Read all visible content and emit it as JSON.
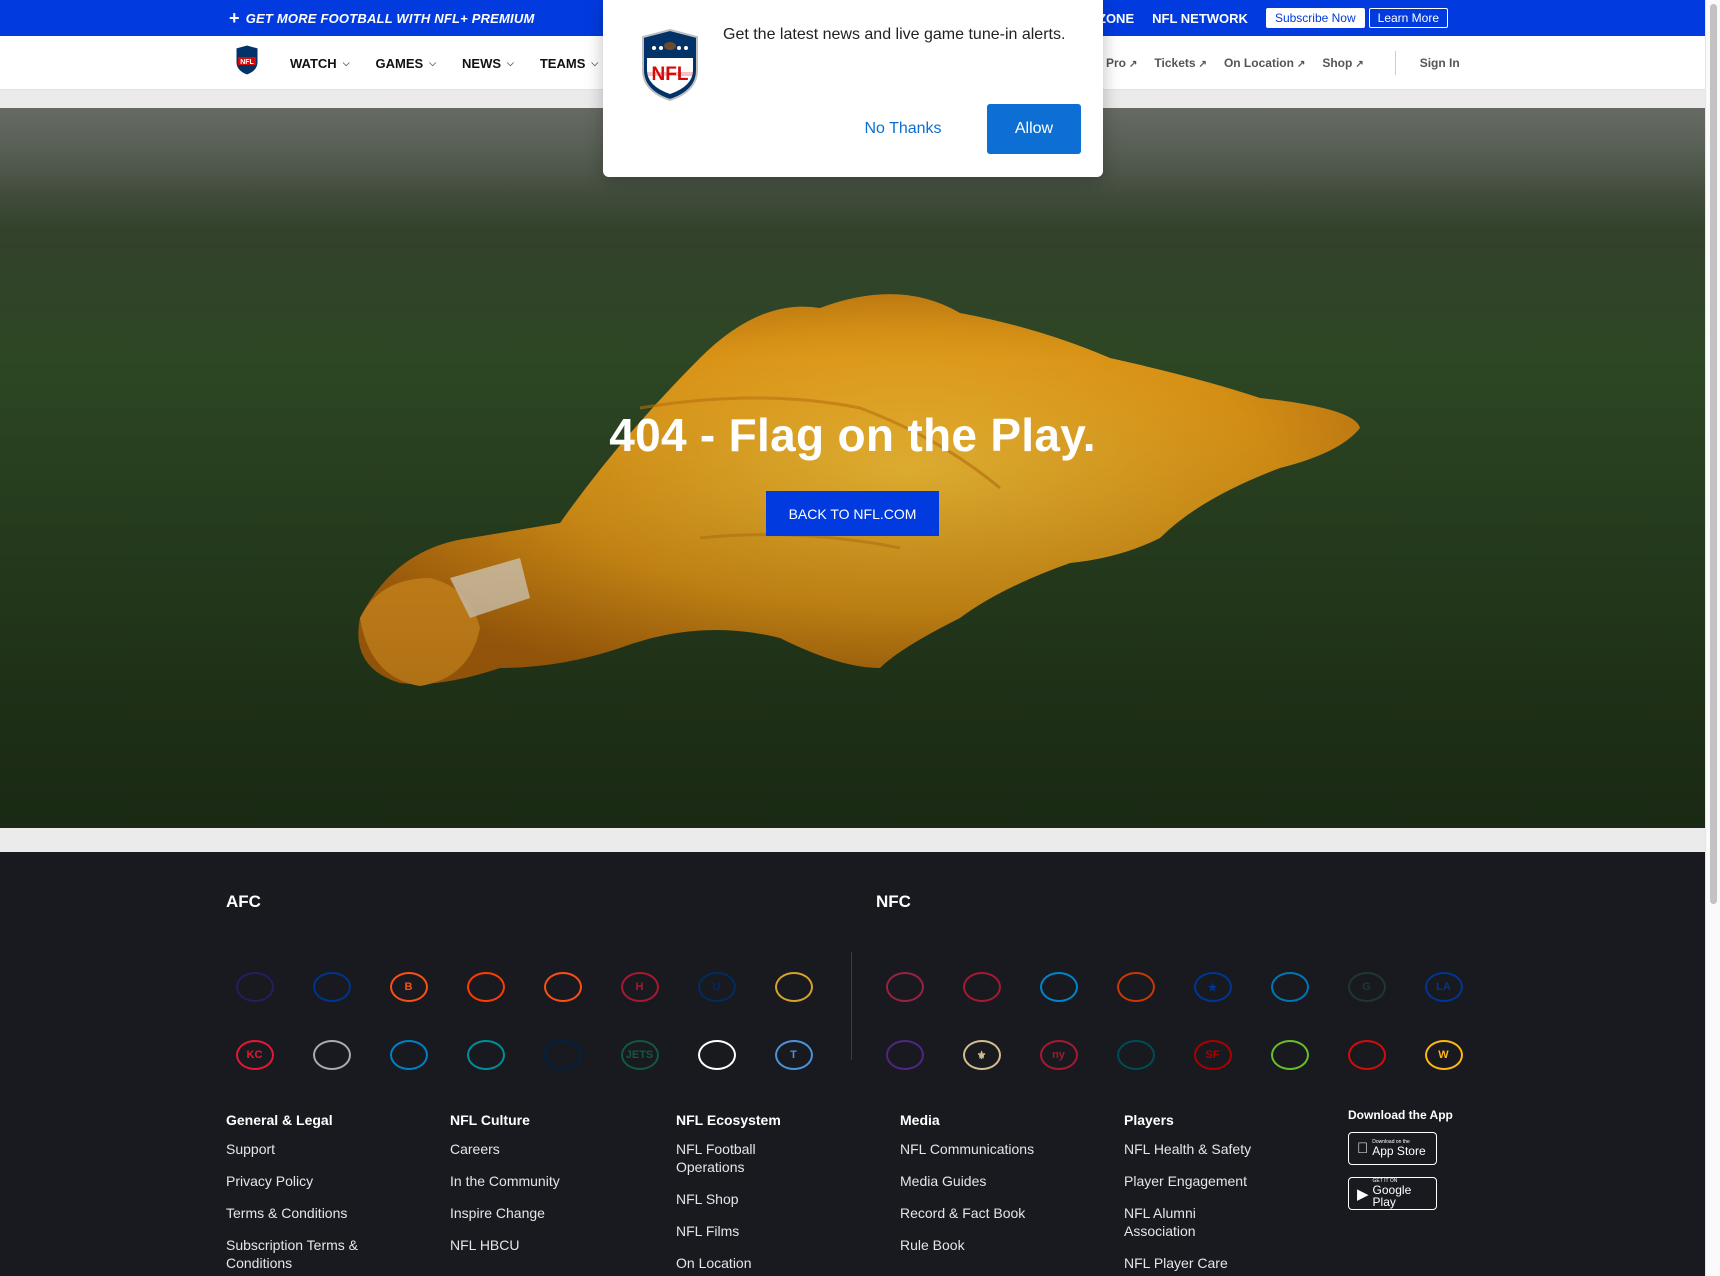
{
  "promo": {
    "text": "GET MORE FOOTBALL WITH NFL+ PREMIUM",
    "redzone": "ZONE",
    "network": "NFL NETWORK",
    "subscribe": "Subscribe Now",
    "learn_more": "Learn More"
  },
  "nav": {
    "items": [
      "WATCH",
      "GAMES",
      "NEWS",
      "TEAMS"
    ],
    "right": [
      "Pro",
      "Tickets",
      "On Location",
      "Shop"
    ],
    "sign_in": "Sign In"
  },
  "hero": {
    "title": "404 - Flag on the Play.",
    "button": "BACK TO NFL.COM"
  },
  "modal": {
    "message": "Get the latest news and live game tune-in alerts.",
    "no_thanks": "No Thanks",
    "allow": "Allow",
    "logo_text": "NFL"
  },
  "footer": {
    "afc_label": "AFC",
    "nfc_label": "NFC",
    "afc_teams": [
      {
        "name": "ravens-logo",
        "color": "#2a1a5e",
        "abbr": ""
      },
      {
        "name": "bills-logo",
        "color": "#00338d",
        "abbr": ""
      },
      {
        "name": "bengals-logo",
        "color": "#fb4f14",
        "abbr": "B"
      },
      {
        "name": "browns-logo",
        "color": "#ff3c00",
        "abbr": ""
      },
      {
        "name": "broncos-logo",
        "color": "#fb4f14",
        "abbr": ""
      },
      {
        "name": "texans-logo",
        "color": "#a71930",
        "abbr": "H"
      },
      {
        "name": "colts-logo",
        "color": "#002c5f",
        "abbr": "U"
      },
      {
        "name": "jaguars-logo",
        "color": "#d7a22a",
        "abbr": ""
      },
      {
        "name": "chiefs-logo",
        "color": "#e31837",
        "abbr": "KC"
      },
      {
        "name": "raiders-logo",
        "color": "#a5acaf",
        "abbr": ""
      },
      {
        "name": "chargers-logo",
        "color": "#0080c6",
        "abbr": ""
      },
      {
        "name": "dolphins-logo",
        "color": "#008e97",
        "abbr": ""
      },
      {
        "name": "patriots-logo",
        "color": "#002244",
        "abbr": ""
      },
      {
        "name": "jets-logo",
        "color": "#125740",
        "abbr": "JETS"
      },
      {
        "name": "steelers-logo",
        "color": "#ffffff",
        "abbr": ""
      },
      {
        "name": "titans-logo",
        "color": "#4b92db",
        "abbr": "T"
      }
    ],
    "nfc_teams": [
      {
        "name": "cardinals-logo",
        "color": "#97233f",
        "abbr": ""
      },
      {
        "name": "falcons-logo",
        "color": "#a71930",
        "abbr": ""
      },
      {
        "name": "panthers-logo",
        "color": "#0085ca",
        "abbr": ""
      },
      {
        "name": "bears-logo",
        "color": "#c83803",
        "abbr": ""
      },
      {
        "name": "cowboys-logo",
        "color": "#003594",
        "abbr": "★"
      },
      {
        "name": "lions-logo",
        "color": "#0076b6",
        "abbr": ""
      },
      {
        "name": "packers-logo",
        "color": "#203731",
        "abbr": "G"
      },
      {
        "name": "rams-logo",
        "color": "#003594",
        "abbr": "LA"
      },
      {
        "name": "vikings-logo",
        "color": "#4f2683",
        "abbr": ""
      },
      {
        "name": "saints-logo",
        "color": "#d3bc8d",
        "abbr": "⚜"
      },
      {
        "name": "giants-logo",
        "color": "#a71930",
        "abbr": "ny"
      },
      {
        "name": "eagles-logo",
        "color": "#004c54",
        "abbr": ""
      },
      {
        "name": "49ers-logo",
        "color": "#aa0000",
        "abbr": "SF"
      },
      {
        "name": "seahawks-logo",
        "color": "#69be28",
        "abbr": ""
      },
      {
        "name": "buccaneers-logo",
        "color": "#d50a0a",
        "abbr": ""
      },
      {
        "name": "commanders-logo",
        "color": "#ffb612",
        "abbr": "W"
      }
    ],
    "columns": [
      {
        "head": "General & Legal",
        "links": [
          "Support",
          "Privacy Policy",
          "Terms & Conditions",
          "Subscription Terms & Conditions"
        ]
      },
      {
        "head": "NFL Culture",
        "links": [
          "Careers",
          "In the Community",
          "Inspire Change",
          "NFL HBCU"
        ]
      },
      {
        "head": "NFL Ecosystem",
        "links": [
          "NFL Football Operations",
          "NFL Shop",
          "NFL Films",
          "On Location"
        ]
      },
      {
        "head": "Media",
        "links": [
          "NFL Communications",
          "Media Guides",
          "Record & Fact Book",
          "Rule Book"
        ]
      },
      {
        "head": "Players",
        "links": [
          "NFL Health & Safety",
          "Player Engagement",
          "NFL Alumni Association",
          "NFL Player Care"
        ]
      }
    ],
    "download_app": "Download the App",
    "app_store": {
      "small": "Download on the",
      "big": "App Store"
    },
    "google_play": {
      "small": "GET IT ON",
      "big": "Google Play"
    }
  },
  "colors": {
    "brand_blue": "#013be0",
    "modal_blue": "#0d6fd3",
    "footer_bg": "#181a20",
    "flag_yellow": "#f2b21a"
  }
}
